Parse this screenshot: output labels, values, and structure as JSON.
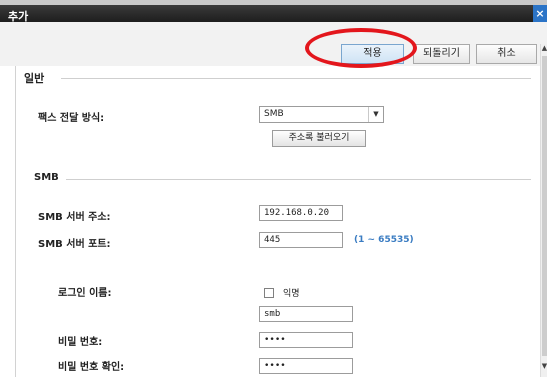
{
  "window": {
    "title": "추가",
    "close_glyph": "×"
  },
  "toolbar": {
    "apply_label": "적용",
    "revert_label": "되돌리기",
    "cancel_label": "취소"
  },
  "general": {
    "heading": "일반",
    "fax_method_label": "팩스 전달 방식:",
    "fax_method_value": "SMB",
    "address_book_button": "주소록 불러오기"
  },
  "smb": {
    "heading": "SMB",
    "server_address_label": "SMB 서버 주소:",
    "server_address_value": "192.168.0.20",
    "server_port_label": "SMB 서버 포트:",
    "server_port_value": "445",
    "port_range_hint": "(1 ~ 65535)",
    "login_name_label": "로그인 이름:",
    "anonymous_label": "익명",
    "anonymous_checked": false,
    "login_name_value": "smb",
    "password_label": "비밀 번호:",
    "password_value": "••••",
    "password_confirm_label": "비밀 번호 확인:",
    "password_confirm_value": "••••"
  },
  "annotation_color": "#e3161c"
}
